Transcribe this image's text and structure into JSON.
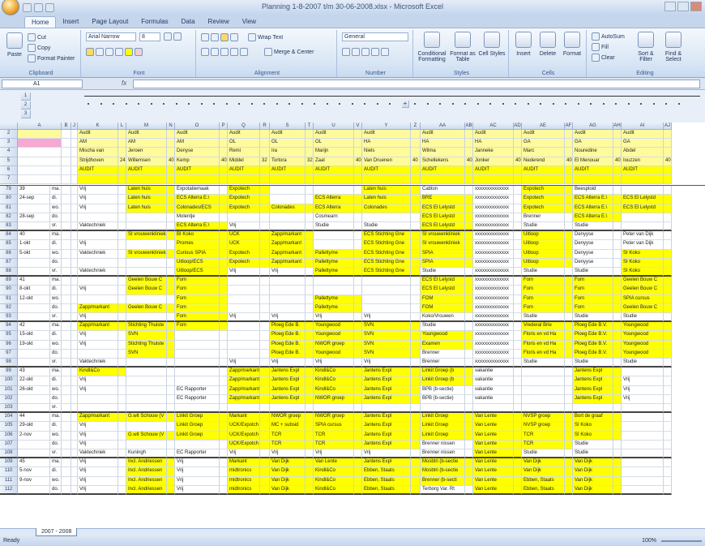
{
  "window": {
    "title": "Planning 1-8-2007 t/m 30-06-2008.xlsx - Microsoft Excel"
  },
  "tabs": [
    "Home",
    "Insert",
    "Page Layout",
    "Formulas",
    "Data",
    "Review",
    "View"
  ],
  "ribbon": {
    "clipboard": {
      "label": "Clipboard",
      "paste": "Paste",
      "cut": "Cut",
      "copy": "Copy",
      "format_painter": "Format Painter"
    },
    "font": {
      "label": "Font",
      "family": "Arial Narrow",
      "size": "8"
    },
    "alignment": {
      "label": "Alignment",
      "wrap": "Wrap Text",
      "merge": "Merge & Center"
    },
    "number": {
      "label": "Number",
      "format": "General"
    },
    "styles": {
      "label": "Styles",
      "conditional": "Conditional Formatting",
      "format_table": "Format as Table",
      "cell_styles": "Cell Styles"
    },
    "cells": {
      "label": "Cells",
      "insert": "Insert",
      "delete": "Delete",
      "format": "Format"
    },
    "editing": {
      "label": "Editing",
      "autosum": "AutoSum",
      "fill": "Fill",
      "clear": "Clear",
      "sort": "Sort & Filter",
      "find": "Find & Select"
    }
  },
  "formula_bar": {
    "name_box": "A1",
    "fx": "fx"
  },
  "outline_levels": [
    "1",
    "2"
  ],
  "outline_rows": [
    "1",
    "2",
    "3"
  ],
  "columns": [
    "A",
    "B",
    "J",
    "K",
    "L",
    "M",
    "N",
    "O",
    "P",
    "Q",
    "R",
    "S",
    "T",
    "U",
    "V",
    "Y",
    "Z",
    "AA",
    "AB",
    "AC",
    "AD",
    "AE",
    "AF",
    "AG",
    "AH",
    "AI",
    "AJ"
  ],
  "header_rows": {
    "audit": [
      "Audit",
      "Audit",
      "Audit",
      "Audit",
      "Audit",
      "Audit",
      "Audit",
      "Audit",
      "Audit",
      "Audit",
      "Audit",
      "Audit"
    ],
    "codes": [
      "AM",
      "AM",
      "AM",
      "OL",
      "OL",
      "OL",
      "HA",
      "HA",
      "HA",
      "GA",
      "GA",
      "GA"
    ],
    "first": [
      "Mischa van",
      "Jeroen",
      "Denyse",
      "Remi",
      "Ira",
      "Marijn",
      "Niels",
      "Wilma",
      "Janneke",
      "Marc",
      "Nouredine",
      "Abdel"
    ],
    "last": [
      "Strijdhoven",
      "Willemsen",
      "Kemp",
      "Middel",
      "Tortora",
      "Zaal",
      "Van Druenen",
      "Schellekens",
      "Jonker",
      "Nederend",
      "El Menouar",
      "Iouzzen"
    ],
    "nums": [
      "24",
      "40",
      "40",
      "32",
      "32",
      "40",
      "40",
      "40",
      "40",
      "40",
      "40",
      "40"
    ],
    "banner": [
      "AUDIT",
      "AUDIT",
      "AUDIT",
      "AUDIT",
      "AUDIT",
      "AUDIT",
      "AUDIT",
      "AUDIT",
      "AUDIT",
      "AUDIT",
      "AUDIT",
      "AUDIT"
    ]
  },
  "weeks": [
    {
      "rows": [
        "79",
        "80",
        "81",
        "82",
        "83"
      ],
      "week": "39",
      "dates": [
        "24-sep",
        "",
        "28-sep"
      ],
      "days": [
        "ma.",
        "di.",
        "wo.",
        "do.",
        "vr."
      ]
    },
    {
      "rows": [
        "84",
        "85",
        "86",
        "87",
        "88"
      ],
      "week": "40",
      "dates": [
        "1-okt",
        "5-okt"
      ],
      "days": [
        "ma.",
        "di.",
        "wo.",
        "do.",
        "vr."
      ]
    },
    {
      "rows": [
        "89",
        "90",
        "91",
        "92",
        "93"
      ],
      "week": "41",
      "dates": [
        "8-okt",
        "12-okt"
      ],
      "days": [
        "ma.",
        "di.",
        "wo.",
        "do.",
        "vr."
      ]
    },
    {
      "rows": [
        "94",
        "95",
        "96",
        "97",
        "98"
      ],
      "week": "42",
      "dates": [
        "15-okt",
        "19-okt"
      ],
      "days": [
        "ma.",
        "di.",
        "wo.",
        "do.",
        "vr."
      ]
    },
    {
      "rows": [
        "99",
        "100",
        "101",
        "102",
        "103"
      ],
      "week": "43",
      "dates": [
        "22-okt",
        "26-okt"
      ],
      "days": [
        "ma.",
        "di.",
        "wo.",
        "do.",
        "vr."
      ]
    },
    {
      "rows": [
        "104",
        "105",
        "106",
        "107",
        "108"
      ],
      "week": "44",
      "dates": [
        "29-okt",
        "2-nov"
      ],
      "days": [
        "ma.",
        "di.",
        "wo.",
        "do.",
        "vr."
      ]
    },
    {
      "rows": [
        "109",
        "110",
        "111",
        "112"
      ],
      "week": "45",
      "dates": [
        "5-nov",
        "9-nov"
      ],
      "days": [
        "ma.",
        "di.",
        "wo.",
        "do."
      ]
    }
  ],
  "cells": [
    [
      "Vrij",
      "Laten huis",
      "Expotatiemaak",
      "Expotech",
      "",
      "",
      "Laten huis",
      "Cablon",
      "xxxxxxxxxxxxxx",
      "Expotech",
      "Beesploid",
      ""
    ],
    [
      "Vrij",
      "Laten huis",
      "ECS Alterra E.\\",
      "Expotech",
      "",
      "ECS Alterra",
      "Laten huis",
      "BRE",
      "xxxxxxxxxxxxxx",
      "Expotech",
      "ECS Alterra E.\\",
      "ECS El Lelystd"
    ],
    [
      "Vrij",
      "Laten huis",
      "Colonades/ECS",
      "Expotech",
      "Colonades",
      "ECS Alterra",
      "Colonades",
      "ECS El Lelystd",
      "xxxxxxxxxxxxxx",
      "Expotech",
      "ECS Alterra E.\\",
      "ECS El Lelystd"
    ],
    [
      "",
      "",
      "Molentje",
      "",
      "",
      "Cosmearn",
      "",
      "ECS El Lelystd",
      "xxxxxxxxxxxxxx",
      "Brenner",
      "ECS Alterra E.\\",
      ""
    ],
    [
      "Vaktechniek",
      "",
      "ECS Alterra E.\\",
      "Vrij",
      "",
      "Studie",
      "Studie",
      "ECS El Lelystd",
      "xxxxxxxxxxxxxx",
      "Studie",
      "Studie",
      ""
    ],
    [
      "",
      "SI vrouwenkliniek",
      "BI Koko",
      "UCK",
      "Zapp/markant",
      "",
      "ECS Stichting Gne",
      "SI vrouwenkliniek",
      "xxxxxxxxxxxxxx",
      "Uitloop",
      "Denyyse",
      "Peter van Dijk"
    ],
    [
      "Vrij",
      "",
      "Promes",
      "UCK",
      "Zapp/markant",
      "",
      "ECS Stichting Gne",
      "SI vrouwenkliniek",
      "xxxxxxxxxxxxxx",
      "Uitloop",
      "Denyyse",
      "Peter van Dijk"
    ],
    [
      "Vaktechniek",
      "SI vrouwenkliniek",
      "Curious SPIA",
      "Expotech",
      "Zapp/markant",
      "Pallettyme",
      "ECS Stichting Gne",
      "SPIA",
      "xxxxxxxxxxxxxx",
      "Uitloop",
      "Denyyse",
      "SI Koko"
    ],
    [
      "",
      "",
      "Uitloop/ECS",
      "Expotech",
      "Zapp/markant",
      "Pallettyme",
      "ECS Stichting Gne",
      "SPIA",
      "xxxxxxxxxxxxxx",
      "Uitloop",
      "Denyyse",
      "SI Koko"
    ],
    [
      "Vaktechniek",
      "",
      "Uitloop/ECS",
      "Vrij",
      "Vrij",
      "Pallettyme",
      "ECS Stichting Gne",
      "Studie",
      "xxxxxxxxxxxxxx",
      "Studie",
      "Studie",
      "SI Koko"
    ],
    [
      "",
      "Geelen Bouw C",
      "Fom",
      "",
      "",
      "",
      "",
      "ECS El Lelystd",
      "xxxxxxxxxxxxxx",
      "Fom",
      "Fom",
      "Geelen Bouw C"
    ],
    [
      "Vrij",
      "Geelen Bouw C",
      "Fom",
      "",
      "",
      "",
      "",
      "ECS El Lelystd",
      "xxxxxxxxxxxxxx",
      "Fom",
      "Fom",
      "Geelen Bouw C"
    ],
    [
      "",
      "",
      "Fom",
      "",
      "",
      "Pallettyme",
      "",
      "FOM",
      "xxxxxxxxxxxxxx",
      "Fom",
      "Fom",
      "SPIA cursus"
    ],
    [
      "Zapp/markant",
      "Geelen Bouw C",
      "Fom",
      "",
      "",
      "Pallettyme",
      "",
      "FOM",
      "xxxxxxxxxxxxxx",
      "Fom",
      "Fom",
      "Geelen Bouw C"
    ],
    [
      "Vrij",
      "",
      "Fom",
      "Vrij",
      "Vrij",
      "Vrij",
      "Vrij",
      "Koko/Vrouwen",
      "xxxxxxxxxxxxxx",
      "Studie",
      "Studie",
      "Studie"
    ],
    [
      "Zapp/markant",
      "Stichting Thuiste",
      "Fom",
      "",
      "Ploeg Ede B.",
      "Youngwood",
      "SVN",
      "Studie",
      "xxxxxxxxxxxxxx",
      "Vrederal Brie",
      "Ploeg Ede B.V.",
      "Youngwood"
    ],
    [
      "Vrij",
      "SVN",
      "",
      "",
      "Ploeg Ede B.",
      "Youngwood",
      "SVN",
      "Youngwood",
      "xxxxxxxxxxxxxx",
      "Floris en vd Ha",
      "Ploeg Ede B.V.",
      "Youngwood"
    ],
    [
      "Vrij",
      "Stichting Thuiste",
      "",
      "",
      "Ploeg Ede B.",
      "NWOR groep",
      "SVN",
      "Examen",
      "xxxxxxxxxxxxxx",
      "Floris en vd Ha",
      "Ploeg Ede B.V.",
      "Youngwood"
    ],
    [
      "",
      "SVN",
      "",
      "",
      "Ploeg Ede B.",
      "Youngwood",
      "SVN",
      "Brenner",
      "xxxxxxxxxxxxxx",
      "Floris en vd Ha",
      "Ploeg Ede B.V.",
      "Youngwood"
    ],
    [
      "Vaktechniek",
      "",
      "",
      "Vrij",
      "Vrij",
      "Vrij",
      "Vrij",
      "Brenner",
      "xxxxxxxxxxxxxx",
      "Studie",
      "Studie",
      "Studie"
    ],
    [
      "Kindl&Co",
      "",
      "",
      "Zapp/markant",
      "Jantens Expl",
      "Kindl&Co",
      "Jantens Expl",
      "Linkit Groep (b",
      "vakantie",
      "",
      "Jantens Expl",
      ""
    ],
    [
      "Vrij",
      "",
      "",
      "Zapp/markant",
      "Jantens Expl",
      "Kindl&Co",
      "Jantens Expl",
      "Linkit Groep (b",
      "vakantie",
      "",
      "Jantens Expl",
      "Vrij"
    ],
    [
      "Vrij",
      "",
      "EC Rapporter",
      "Zapp/markant",
      "Jantens Expl",
      "Kindl&Co",
      "Jantens Expl",
      "BPB (b-sectie)",
      "vakantie",
      "",
      "Jantens Expl",
      "Vrij"
    ],
    [
      "",
      "",
      "EC Rapporter",
      "Zapp/markant",
      "Jantens Expl",
      "NWOR groep",
      "Jantens Expl",
      "BPB (b-sectie)",
      "vakantie",
      "",
      "Jantens Expl",
      "Vrij"
    ],
    [
      "",
      "",
      "",
      "",
      "",
      "",
      "",
      "",
      "",
      "",
      "",
      ""
    ],
    [
      "Zapp/markant",
      "G.wit Schouw (V",
      "Linkit Groep",
      "Markant",
      "NWOR groep",
      "NWOR groep",
      "Jantens Expl",
      "Linkit Groep",
      "Van Lente",
      "NVSP groep",
      "Bort de graaf",
      ""
    ],
    [
      "Vrij",
      "",
      "Linkit Groep",
      "UCK/Expotch",
      "MC + subsid",
      "SPIA cursus",
      "Jantens Expl",
      "Linkit Groep",
      "Van Lente",
      "NVSP groep",
      "SI Koko",
      ""
    ],
    [
      "Vrij",
      "G.wit Schouw (V",
      "Linkit Groep",
      "UCK/Expotch",
      "TCR",
      "TCR",
      "Jantens Expl",
      "Linkit Groep",
      "Van Lente",
      "TCR",
      "SI Koko",
      ""
    ],
    [
      "Vrij",
      "",
      "",
      "UCK/Expotch",
      "TCR",
      "TCR",
      "Jantens Expl",
      "Brenner nissen",
      "Van Lente",
      "TCR",
      "Studie",
      ""
    ],
    [
      "Vaktechniek",
      "Kuningh",
      "EC Rapporter",
      "Vrij",
      "Vrij",
      "Vrij",
      "Vrij",
      "Brenner nissen",
      "Van Lente",
      "Studie",
      "Studie",
      ""
    ],
    [
      "Vrij",
      "Incl. Andriessen",
      "Vrij",
      "Markant",
      "Van Dijk",
      "Van Lente",
      "Jantens Expl",
      "Mosbtri (b-sectie",
      "Van Lente",
      "Van Dijk",
      "Van Dijk",
      ""
    ],
    [
      "Vrij",
      "Incl. Andriessen",
      "Vrij",
      "midtronics",
      "Van Dijk",
      "Kindl&Co",
      "Ebben, Staats",
      "Mosbtri (b-sectie",
      "Van Lente",
      "Van Dijk",
      "Van Dijk",
      ""
    ],
    [
      "Vrij",
      "Incl. Andriessen",
      "Vrij",
      "midtronics",
      "Van Dijk",
      "Kindl&Co",
      "Ebben, Staats",
      "Brenner (b-secti",
      "Van Lente",
      "Ebben, Staats",
      "Van Dijk",
      ""
    ],
    [
      "Vrij",
      "Incl. Andriessen",
      "Vrij",
      "midtronics",
      "Van Dijk",
      "Kindl&Co",
      "Ebben, Staats",
      "Terborg Var. Rt",
      "Van Lente",
      "Ebben, Staats",
      "Van Dijk",
      ""
    ]
  ],
  "sheet": {
    "tab": "2007 - 2008"
  },
  "status": {
    "text": "Ready",
    "zoom": "100%"
  }
}
